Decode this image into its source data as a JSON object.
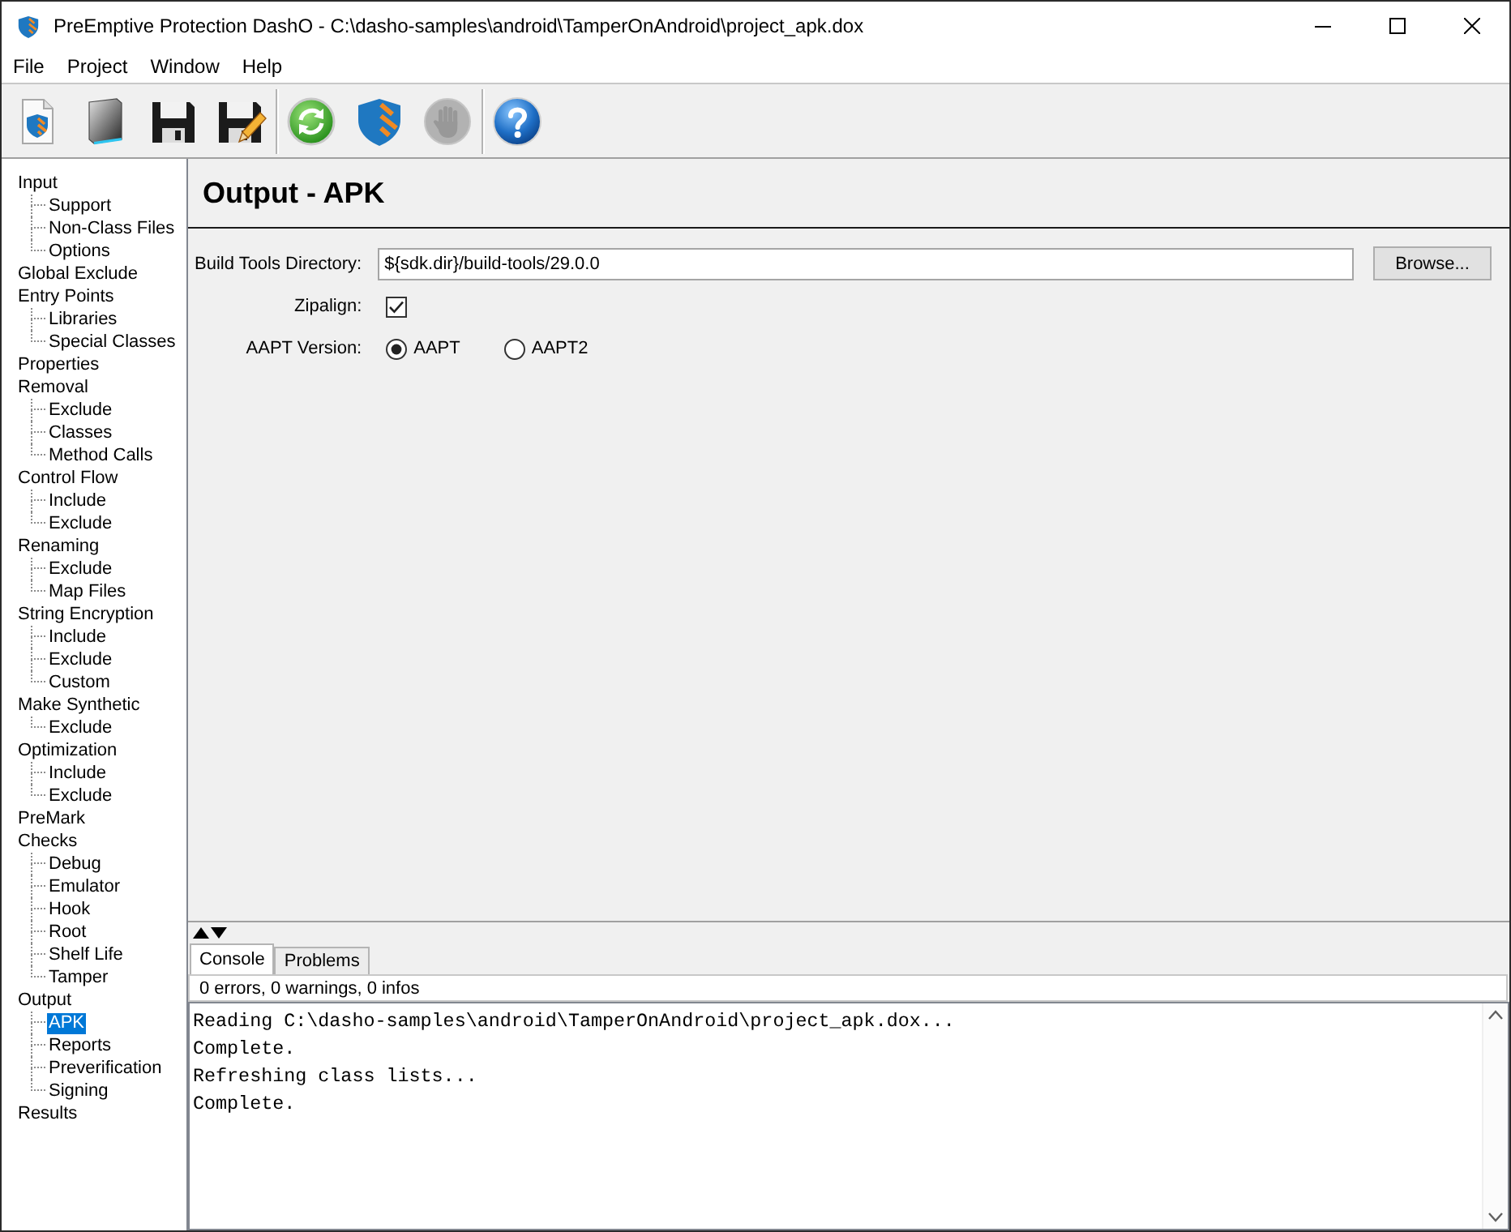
{
  "window": {
    "title": "PreEmptive Protection DashO - C:\\dasho-samples\\android\\TamperOnAndroid\\project_apk.dox"
  },
  "menu": [
    "File",
    "Project",
    "Window",
    "Help"
  ],
  "toolbar": [
    {
      "kind": "new",
      "disabled": false
    },
    {
      "kind": "open",
      "disabled": false
    },
    {
      "kind": "save",
      "disabled": false
    },
    {
      "kind": "save-as",
      "disabled": false
    },
    {
      "kind": "separator"
    },
    {
      "kind": "refresh",
      "disabled": false
    },
    {
      "kind": "build",
      "disabled": false
    },
    {
      "kind": "stop",
      "disabled": true
    },
    {
      "kind": "separator"
    },
    {
      "kind": "help",
      "disabled": false
    }
  ],
  "sidebar": {
    "items": [
      {
        "label": "Input",
        "selected": false,
        "children": [
          {
            "label": "Support",
            "selected": false
          },
          {
            "label": "Non-Class Files",
            "selected": false
          },
          {
            "label": "Options",
            "selected": false
          }
        ]
      },
      {
        "label": "Global Exclude",
        "selected": false
      },
      {
        "label": "Entry Points",
        "selected": false,
        "children": [
          {
            "label": "Libraries",
            "selected": false
          },
          {
            "label": "Special Classes",
            "selected": false
          }
        ]
      },
      {
        "label": "Properties",
        "selected": false
      },
      {
        "label": "Removal",
        "selected": false,
        "children": [
          {
            "label": "Exclude",
            "selected": false
          },
          {
            "label": "Classes",
            "selected": false
          },
          {
            "label": "Method Calls",
            "selected": false
          }
        ]
      },
      {
        "label": "Control Flow",
        "selected": false,
        "children": [
          {
            "label": "Include",
            "selected": false
          },
          {
            "label": "Exclude",
            "selected": false
          }
        ]
      },
      {
        "label": "Renaming",
        "selected": false,
        "children": [
          {
            "label": "Exclude",
            "selected": false
          },
          {
            "label": "Map Files",
            "selected": false
          }
        ]
      },
      {
        "label": "String Encryption",
        "selected": false,
        "children": [
          {
            "label": "Include",
            "selected": false
          },
          {
            "label": "Exclude",
            "selected": false
          },
          {
            "label": "Custom",
            "selected": false
          }
        ]
      },
      {
        "label": "Make Synthetic",
        "selected": false,
        "children": [
          {
            "label": "Exclude",
            "selected": false
          }
        ]
      },
      {
        "label": "Optimization",
        "selected": false,
        "children": [
          {
            "label": "Include",
            "selected": false
          },
          {
            "label": "Exclude",
            "selected": false
          }
        ]
      },
      {
        "label": "PreMark",
        "selected": false
      },
      {
        "label": "Checks",
        "selected": false,
        "children": [
          {
            "label": "Debug",
            "selected": false
          },
          {
            "label": "Emulator",
            "selected": false
          },
          {
            "label": "Hook",
            "selected": false
          },
          {
            "label": "Root",
            "selected": false
          },
          {
            "label": "Shelf Life",
            "selected": false
          },
          {
            "label": "Tamper",
            "selected": false
          }
        ]
      },
      {
        "label": "Output",
        "selected": false,
        "children": [
          {
            "label": "APK",
            "selected": true
          },
          {
            "label": "Reports",
            "selected": false
          },
          {
            "label": "Preverification",
            "selected": false
          },
          {
            "label": "Signing",
            "selected": false
          }
        ]
      },
      {
        "label": "Results",
        "selected": false
      }
    ]
  },
  "panel": {
    "title": "Output - APK",
    "build_tools_directory": {
      "label": "Build Tools Directory:",
      "value": "${sdk.dir}/build-tools/29.0.0",
      "button": "Browse..."
    },
    "zipalign": {
      "label": "Zipalign:",
      "checked": true
    },
    "aapt_version": {
      "label": "AAPT Version:",
      "options": [
        {
          "label": "AAPT",
          "selected": true
        },
        {
          "label": "AAPT2",
          "selected": false
        }
      ]
    }
  },
  "console": {
    "tabs": [
      {
        "label": "Console",
        "selected": true
      },
      {
        "label": "Problems",
        "selected": false
      }
    ],
    "summary": "0 errors, 0 warnings, 0 infos",
    "lines": [
      "Reading C:\\dasho-samples\\android\\TamperOnAndroid\\project_apk.dox...",
      "Complete.",
      "Refreshing class lists...",
      "Complete."
    ]
  }
}
